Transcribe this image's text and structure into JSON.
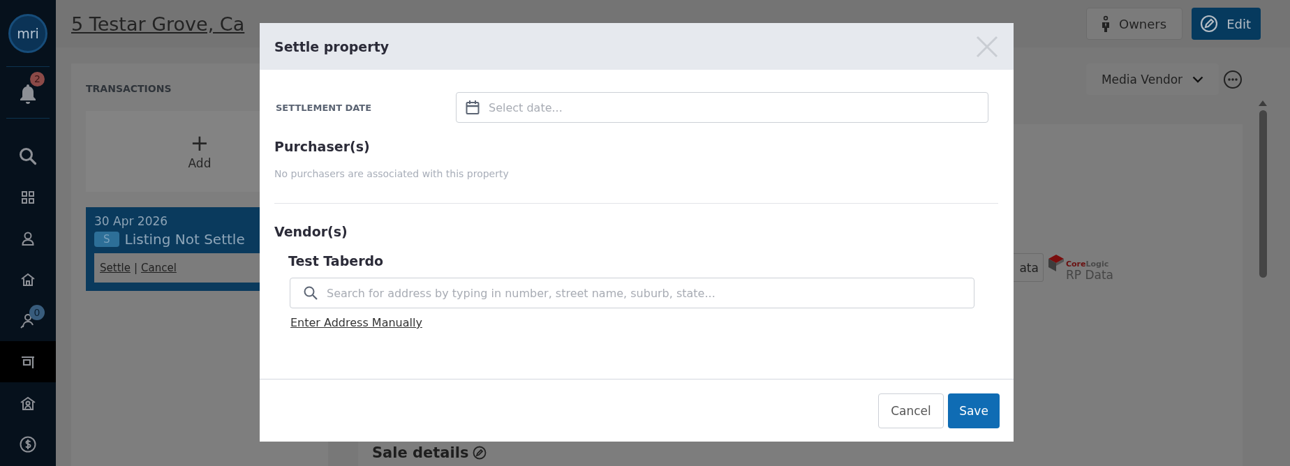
{
  "sidebar": {
    "logo": "mri",
    "notification_badge": "2",
    "items": [
      {
        "kind": "search",
        "selected": false
      },
      {
        "kind": "grid",
        "selected": false
      },
      {
        "kind": "person",
        "selected": false
      },
      {
        "kind": "house",
        "selected": false
      },
      {
        "kind": "people",
        "selected": false,
        "badge": "0"
      },
      {
        "kind": "sign",
        "selected": true
      },
      {
        "kind": "house-person",
        "selected": false
      },
      {
        "kind": "dollar",
        "selected": false
      }
    ]
  },
  "header": {
    "title": "5 Testar Grove, Ca",
    "buttons": [
      {
        "kind": "owners",
        "label": "Owners"
      },
      {
        "kind": "edit",
        "label": "Edit"
      }
    ]
  },
  "transactions": {
    "heading": "TRANSACTIONS",
    "add_icon": "+",
    "add_label": "Add",
    "cards": [
      {
        "date": "30 Apr 2026",
        "badge": "S",
        "status": "Listing Not Settle",
        "links": [
          "Settle",
          "Cancel"
        ],
        "separator": "|"
      }
    ]
  },
  "main": {
    "dropdown": "Media Vendor",
    "partial_button": "ata",
    "logo_brand": "**Core**Logic",
    "logo_product": "RP Data",
    "section_title": "Sale details"
  },
  "modal": {
    "title": "Settle property",
    "settlement_label": "SETTLEMENT DATE",
    "date_placeholder": "Select date...",
    "purchasers_heading": "Purchaser(s)",
    "purchasers_note": "No purchasers are associated with this property",
    "vendors_heading": "Vendor(s)",
    "vendors": [
      {
        "name": "Test Taberdo",
        "search_placeholder": "Search for address by typing in number, street name, suburb, state...",
        "manual_link": "Enter Address Manually"
      }
    ],
    "buttons": [
      {
        "kind": "secondary",
        "label": "Cancel"
      },
      {
        "kind": "primary",
        "label": "Save"
      }
    ]
  }
}
